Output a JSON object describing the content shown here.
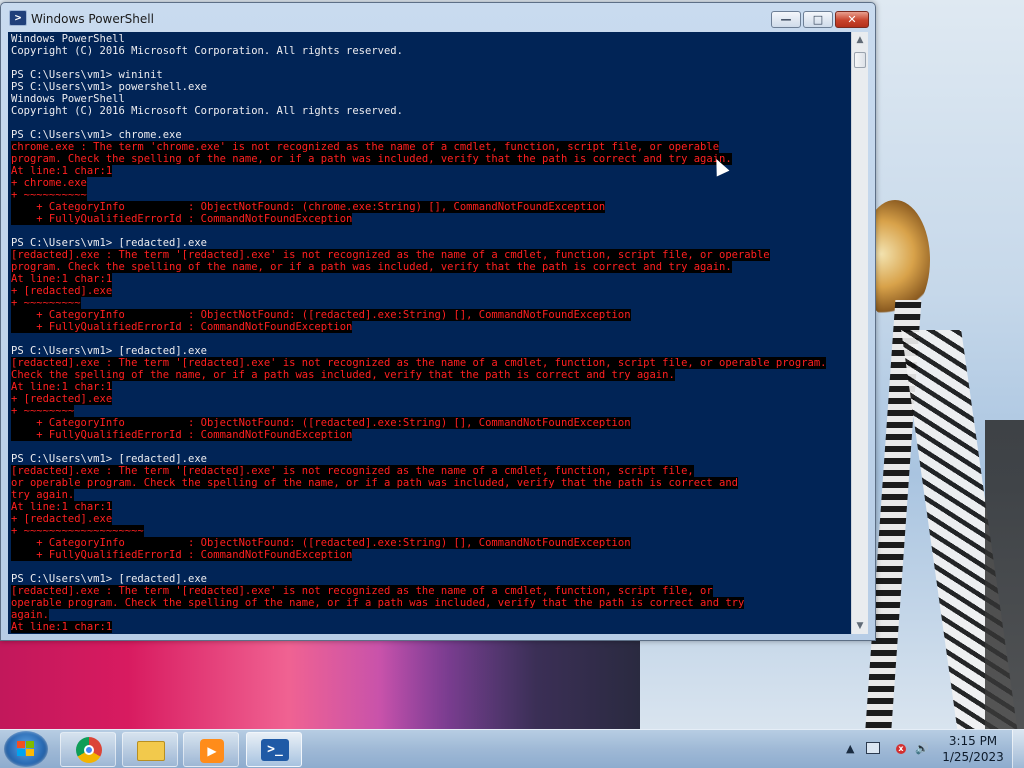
{
  "window": {
    "title": "Windows PowerShell",
    "buttons": {
      "minimize": "—",
      "maximize": "□",
      "close": "✕"
    },
    "icon": "powershell-icon"
  },
  "console": {
    "lines": [
      {
        "type": "out",
        "text": "Windows PowerShell"
      },
      {
        "type": "out",
        "text": "Copyright (C) 2016 Microsoft Corporation. All rights reserved."
      },
      {
        "type": "out",
        "text": ""
      },
      {
        "type": "out",
        "text": "PS C:\\Users\\vm1> wininit"
      },
      {
        "type": "out",
        "text": "PS C:\\Users\\vm1> powershell.exe"
      },
      {
        "type": "out",
        "text": "Windows PowerShell"
      },
      {
        "type": "out",
        "text": "Copyright (C) 2016 Microsoft Corporation. All rights reserved."
      },
      {
        "type": "out",
        "text": ""
      },
      {
        "type": "out",
        "text": "PS C:\\Users\\vm1> chrome.exe"
      },
      {
        "type": "err",
        "text": "chrome.exe : The term 'chrome.exe' is not recognized as the name of a cmdlet, function, script file, or operable"
      },
      {
        "type": "err",
        "text": "program. Check the spelling of the name, or if a path was included, verify that the path is correct and try again."
      },
      {
        "type": "err",
        "text": "At line:1 char:1"
      },
      {
        "type": "err",
        "text": "+ chrome.exe"
      },
      {
        "type": "err",
        "text": "+ ~~~~~~~~~~"
      },
      {
        "type": "err",
        "text": "    + CategoryInfo          : ObjectNotFound: (chrome.exe:String) [], CommandNotFoundException"
      },
      {
        "type": "err",
        "text": "    + FullyQualifiedErrorId : CommandNotFoundException"
      },
      {
        "type": "out",
        "text": ""
      },
      {
        "type": "out",
        "text": "PS C:\\Users\\vm1> [redacted].exe"
      },
      {
        "type": "err",
        "text": "[redacted].exe : The term '[redacted].exe' is not recognized as the name of a cmdlet, function, script file, or operable"
      },
      {
        "type": "err",
        "text": "program. Check the spelling of the name, or if a path was included, verify that the path is correct and try again."
      },
      {
        "type": "err",
        "text": "At line:1 char:1"
      },
      {
        "type": "err",
        "text": "+ [redacted].exe"
      },
      {
        "type": "err",
        "text": "+ ~~~~~~~~~"
      },
      {
        "type": "err",
        "text": "    + CategoryInfo          : ObjectNotFound: ([redacted].exe:String) [], CommandNotFoundException"
      },
      {
        "type": "err",
        "text": "    + FullyQualifiedErrorId : CommandNotFoundException"
      },
      {
        "type": "out",
        "text": ""
      },
      {
        "type": "out",
        "text": "PS C:\\Users\\vm1> [redacted].exe"
      },
      {
        "type": "err",
        "text": "[redacted].exe : The term '[redacted].exe' is not recognized as the name of a cmdlet, function, script file, or operable program."
      },
      {
        "type": "err",
        "text": "Check the spelling of the name, or if a path was included, verify that the path is correct and try again."
      },
      {
        "type": "err",
        "text": "At line:1 char:1"
      },
      {
        "type": "err",
        "text": "+ [redacted].exe"
      },
      {
        "type": "err",
        "text": "+ ~~~~~~~~"
      },
      {
        "type": "err",
        "text": "    + CategoryInfo          : ObjectNotFound: ([redacted].exe:String) [], CommandNotFoundException"
      },
      {
        "type": "err",
        "text": "    + FullyQualifiedErrorId : CommandNotFoundException"
      },
      {
        "type": "out",
        "text": ""
      },
      {
        "type": "out",
        "text": "PS C:\\Users\\vm1> [redacted].exe"
      },
      {
        "type": "err",
        "text": "[redacted].exe : The term '[redacted].exe' is not recognized as the name of a cmdlet, function, script file,"
      },
      {
        "type": "err",
        "text": "or operable program. Check the spelling of the name, or if a path was included, verify that the path is correct and"
      },
      {
        "type": "err",
        "text": "try again."
      },
      {
        "type": "err",
        "text": "At line:1 char:1"
      },
      {
        "type": "err",
        "text": "+ [redacted].exe"
      },
      {
        "type": "err",
        "text": "+ ~~~~~~~~~~~~~~~~~~~"
      },
      {
        "type": "err",
        "text": "    + CategoryInfo          : ObjectNotFound: ([redacted].exe:String) [], CommandNotFoundException"
      },
      {
        "type": "err",
        "text": "    + FullyQualifiedErrorId : CommandNotFoundException"
      },
      {
        "type": "out",
        "text": ""
      },
      {
        "type": "out",
        "text": "PS C:\\Users\\vm1> [redacted].exe"
      },
      {
        "type": "err",
        "text": "[redacted].exe : The term '[redacted].exe' is not recognized as the name of a cmdlet, function, script file, or"
      },
      {
        "type": "err",
        "text": "operable program. Check the spelling of the name, or if a path was included, verify that the path is correct and try"
      },
      {
        "type": "err",
        "text": "again."
      },
      {
        "type": "err",
        "text": "At line:1 char:1"
      }
    ],
    "colors": {
      "background": "#012456",
      "text": "#eeedf0",
      "error_text": "#ff2020",
      "error_background": "#000000"
    }
  },
  "scrollbar": {
    "up_arrow": "▲",
    "down_arrow": "▼"
  },
  "taskbar": {
    "start_icon": "windows-start-icon",
    "pinned": [
      {
        "name": "chrome",
        "icon": "chrome-icon"
      },
      {
        "name": "explorer",
        "icon": "folder-icon"
      },
      {
        "name": "media-player",
        "icon": "media-player-icon"
      },
      {
        "name": "powershell",
        "icon": "powershell-icon",
        "active": true
      }
    ],
    "tray": {
      "arrow": "▲",
      "volume": "🔊"
    },
    "clock": {
      "time": "3:15 PM",
      "date": "1/25/2023"
    }
  }
}
